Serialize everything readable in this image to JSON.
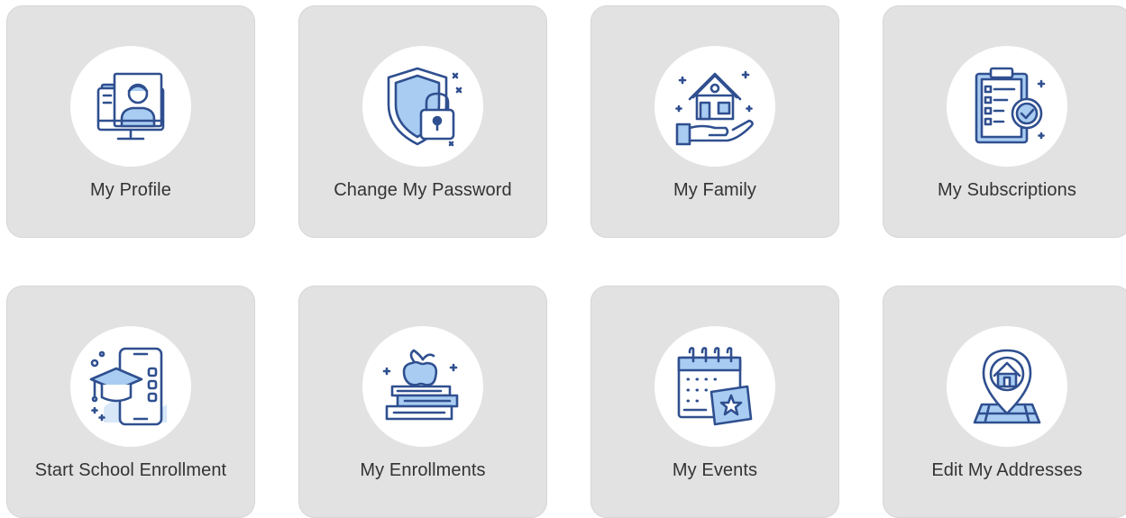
{
  "tiles": [
    {
      "label": "My Profile",
      "icon": "profile-monitor-icon"
    },
    {
      "label": "Change My Password",
      "icon": "shield-lock-icon"
    },
    {
      "label": "My Family",
      "icon": "house-hand-icon"
    },
    {
      "label": "My Subscriptions",
      "icon": "clipboard-check-icon"
    },
    {
      "label": "Start School Enrollment",
      "icon": "graduation-phone-icon"
    },
    {
      "label": "My Enrollments",
      "icon": "books-apple-icon"
    },
    {
      "label": "My Events",
      "icon": "calendar-star-icon"
    },
    {
      "label": "Edit My Addresses",
      "icon": "location-pin-house-icon"
    }
  ],
  "colors": {
    "tile_background": "#e2e2e2",
    "icon_stroke": "#2f4f8f",
    "icon_fill": "#a9cdf2"
  }
}
